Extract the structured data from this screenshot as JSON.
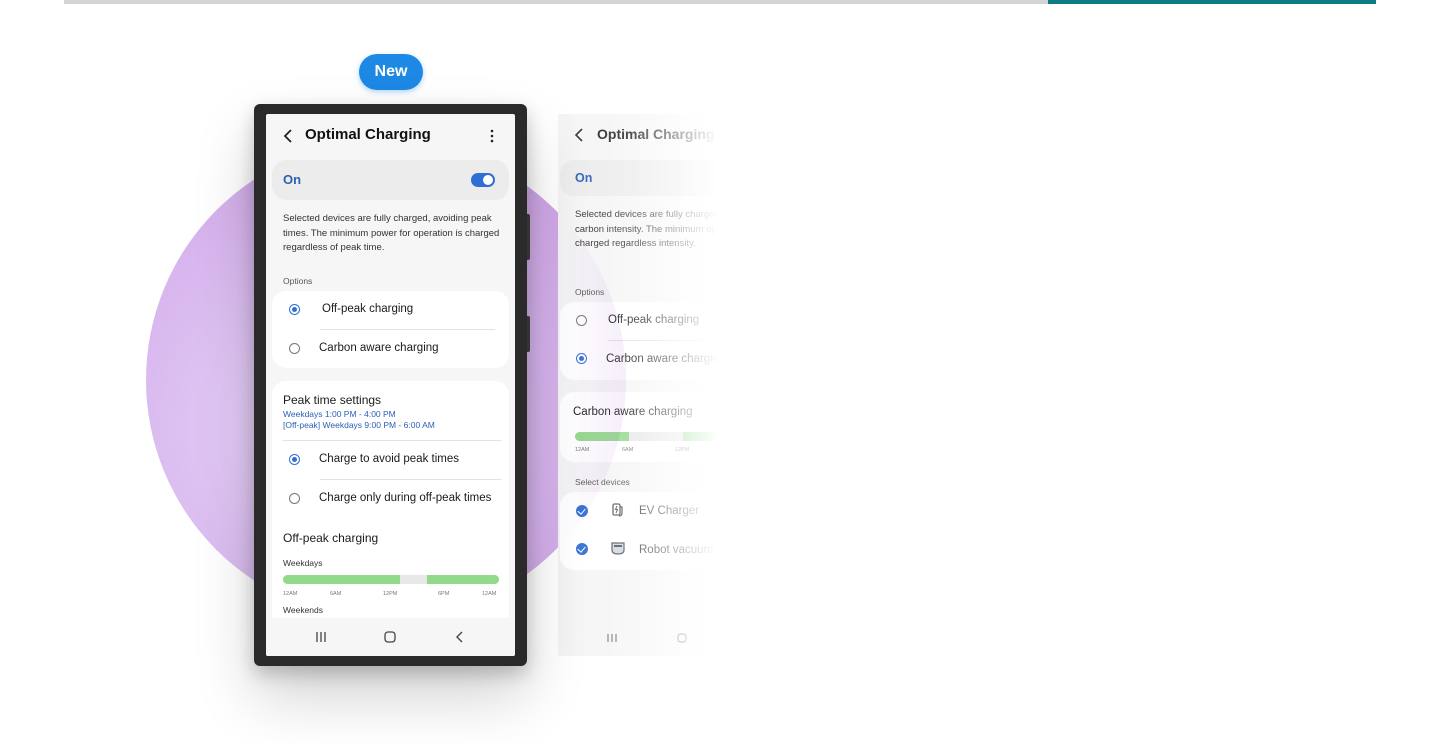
{
  "progress": {
    "fraction_filled": 0.25,
    "track_color": "#d4d4d4",
    "fill_color": "#0f7c84"
  },
  "badge": {
    "label": "New",
    "color": "#1e88e5"
  },
  "screen1": {
    "title": "Optimal Charging",
    "toggle": {
      "label": "On",
      "state": true
    },
    "description": "Selected devices are fully charged, avoiding peak times. The minimum power for operation is charged regardless of peak time.",
    "options_header": "Options",
    "options": [
      {
        "label": "Off-peak charging",
        "selected": true
      },
      {
        "label": "Carbon aware charging",
        "selected": false
      }
    ],
    "peak": {
      "title": "Peak time settings",
      "line1": "Weekdays 1:00 PM - 4:00 PM",
      "line2": "[Off-peak] Weekdays 9:00 PM - 6:00 AM",
      "options": [
        {
          "label": "Charge to avoid peak times",
          "selected": true
        },
        {
          "label": "Charge only during off-peak times",
          "selected": false
        }
      ]
    },
    "offpeak": {
      "title": "Off-peak charging",
      "weekdays_label": "Weekdays",
      "weekends_label": "Weekends",
      "ticks": [
        "12AM",
        "6AM",
        "12PM",
        "6PM",
        "12AM"
      ]
    }
  },
  "screen2": {
    "title": "Optimal Charging",
    "toggle_label": "On",
    "description": "Selected devices are fully charged of low carbon intensity. The minimum operation is charged regardless intensity.",
    "options_header": "Options",
    "options": [
      {
        "label": "Off-peak charging",
        "selected": false
      },
      {
        "label": "Carbon aware charging",
        "selected": true
      }
    ],
    "carbon_title": "Carbon aware charging",
    "ticks": [
      "12AM",
      "6AM",
      "12PM"
    ],
    "devices_header": "Select devices",
    "devices": [
      {
        "label": "EV Charger",
        "icon": "ev-charger-icon",
        "checked": true
      },
      {
        "label": "Robot vacuum",
        "icon": "robot-vacuum-icon",
        "checked": true
      }
    ]
  },
  "colors": {
    "accent": "#2f6fd4",
    "schedule_green": "#93d98a",
    "circle_purple": "#d9b8ef"
  }
}
